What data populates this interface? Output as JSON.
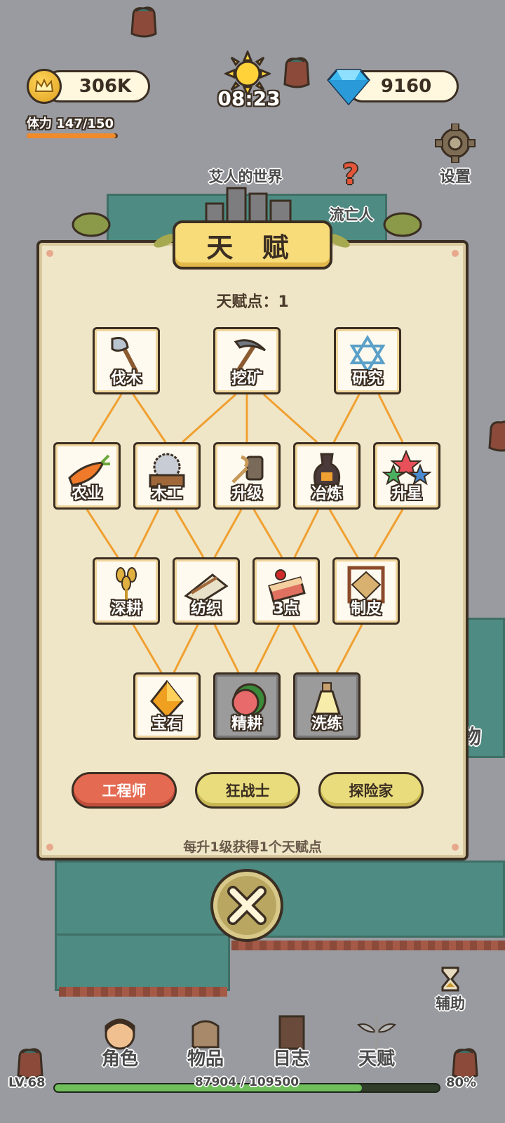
{
  "hud": {
    "gold": "306K",
    "time": "08:23",
    "gems": "9160",
    "stamina_label": "体力 147/150",
    "stamina_fraction": 0.98,
    "settings_label": "设置"
  },
  "map": {
    "world_name": "艾人的世界",
    "npc_name": "流亡人",
    "side_label": "物"
  },
  "panel": {
    "title": "天 赋",
    "points_label": "天赋点：1",
    "hint": "每升1级获得1个天赋点"
  },
  "talents": [
    {
      "label": "伐木",
      "icon": "axe-icon",
      "locked": false
    },
    {
      "label": "挖矿",
      "icon": "pickaxe-icon",
      "locked": false
    },
    {
      "label": "研究",
      "icon": "hexagram-icon",
      "locked": false
    },
    {
      "label": "农业",
      "icon": "carrot-icon",
      "locked": false
    },
    {
      "label": "木工",
      "icon": "saw-icon",
      "locked": false
    },
    {
      "label": "升级",
      "icon": "tools-icon",
      "locked": false
    },
    {
      "label": "冶炼",
      "icon": "furnace-icon",
      "locked": false
    },
    {
      "label": "升星",
      "icon": "stars-icon",
      "locked": false
    },
    {
      "label": "深耕",
      "icon": "wheat-icon",
      "locked": false
    },
    {
      "label": "纺织",
      "icon": "loom-icon",
      "locked": false
    },
    {
      "label": "3点",
      "icon": "cake-icon",
      "locked": false
    },
    {
      "label": "制皮",
      "icon": "leather-rack-icon",
      "locked": false
    },
    {
      "label": "宝石",
      "icon": "gem-icon",
      "locked": false
    },
    {
      "label": "精耕",
      "icon": "melon-icon",
      "locked": true
    },
    {
      "label": "洗练",
      "icon": "potion-icon",
      "locked": true
    }
  ],
  "classes": {
    "engineer": "工程师",
    "berserker": "狂战士",
    "explorer": "探险家"
  },
  "side": {
    "assist_label": "辅助"
  },
  "nav": {
    "character": "角色",
    "items": "物品",
    "journal": "日志",
    "talent": "天赋"
  },
  "footer": {
    "level": "LV.68",
    "xp": "87904 / 109500",
    "percent": "80%",
    "xp_fraction": 0.8
  },
  "colors": {
    "accent": "#e46a52",
    "panel": "#efe6c8",
    "outline": "#3b2e22",
    "link": "#f0a030"
  }
}
